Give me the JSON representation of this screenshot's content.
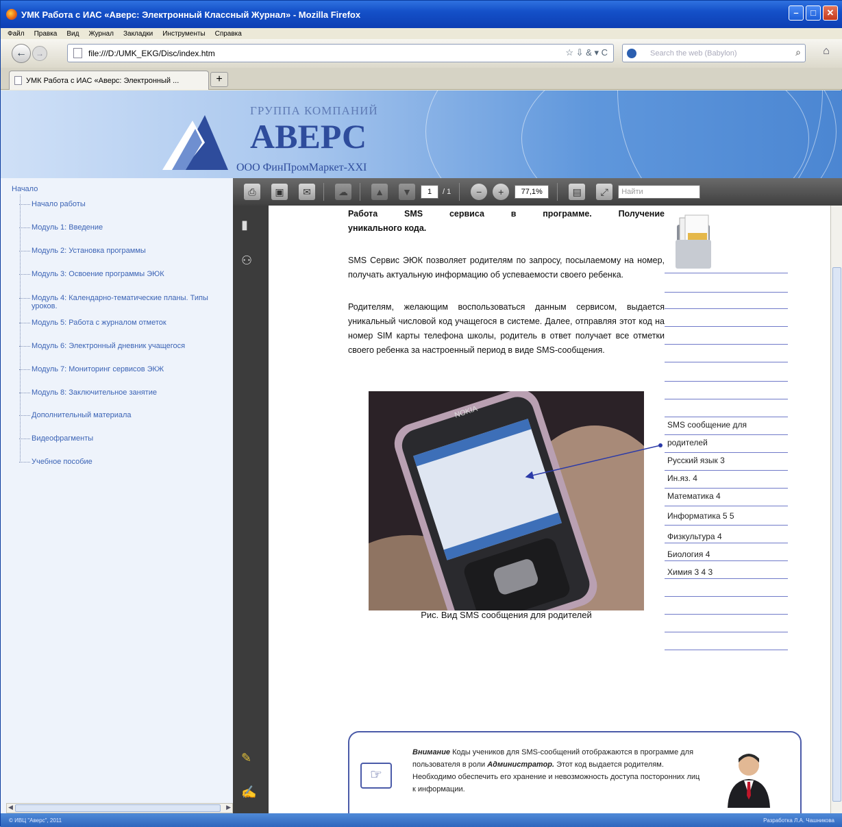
{
  "window": {
    "title": "УМК Работа с ИАС «Аверс: Электронный Классный Журнал» - Mozilla Firefox",
    "min": "–",
    "max": "□",
    "close": "✕"
  },
  "menu": [
    "Файл",
    "Правка",
    "Вид",
    "Журнал",
    "Закладки",
    "Инструменты",
    "Справка"
  ],
  "nav": {
    "back": "←",
    "forward": "→",
    "url": "file:///D:/UMK_EKG/Disc/index.htm",
    "url_icons": "☆ ⇩ & ▾ C",
    "search_placeholder": "Search the web (Babylon)",
    "search_icon": "search-icon",
    "home": "⌂"
  },
  "tab": {
    "title": "УМК Работа с ИАС «Аверс: Электронный ...",
    "new_tab": "+"
  },
  "banner": {
    "group": "ГРУППА КОМПАНИЙ",
    "brand": "АВЕРС",
    "company": "ООО ФинПромМаркет-XXI"
  },
  "sidebar": {
    "root": "Начало",
    "items": [
      "Начало работы",
      "Модуль 1: Введение",
      "Модуль 2: Установка программы",
      "Модуль 3: Освоение программы ЭЮК",
      "Модуль 4: Календарно-тематические планы. Типы уроков.",
      "Модуль 5: Работа с журналом отметок",
      "Модуль 6: Электронный дневник учащегося",
      "Модуль 7: Мониторинг сервисов ЭКЖ",
      "Модуль 8: Заключительное занятие",
      "Дополнительный материала",
      "Видеофрагменты",
      "Учебное пособие"
    ]
  },
  "pdf_toolbar": {
    "page_current": "1",
    "page_total": "/ 1",
    "zoom": "77,1%",
    "find_placeholder": "Найти"
  },
  "doc": {
    "title_line1": "Работа SMS сервиса в программе. Получение",
    "title_line2": "уникального кода.",
    "para1": "SMS Сервис ЭЮК позволяет родителям по запросу, посылаемому на номер, получать актуальную информацию об успеваемости своего ребенка.",
    "para2": "Родителям, желающим воспользоваться данным сервисом, выдается уникальный числовой код учащегося в системе. Далее, отправляя этот код на номер SIM карты телефона школы, родитель в ответ получает все отметки своего ребенка за настроенный период в виде SMS-сообщения.",
    "caption": "Рис. Вид SMS сообщения для родителей",
    "phone_brand": "NOKIA",
    "sms_lines": [
      "SMS сообщение для",
      "родителей",
      "Русский язык  3",
      "Ин.яз. 4",
      "Математика 4",
      "Информатика 5 5",
      "Физкультура 4",
      "Биология 4",
      "Химия 3 4 3"
    ],
    "note_lead": "Внимание",
    "note_text1": " Коды учеников для SMS-сообщений отображаются в программе для пользователя в роли ",
    "note_role": "Администратор.",
    "note_text2": " Этот код выдается родителям. Необходимо обеспечить его хранение и невозможность доступа посторонних лиц к информации."
  },
  "status": {
    "left": "© ИВЦ \"Аверс\", 2011",
    "right": "Разработка Л.А. Чашникова"
  }
}
